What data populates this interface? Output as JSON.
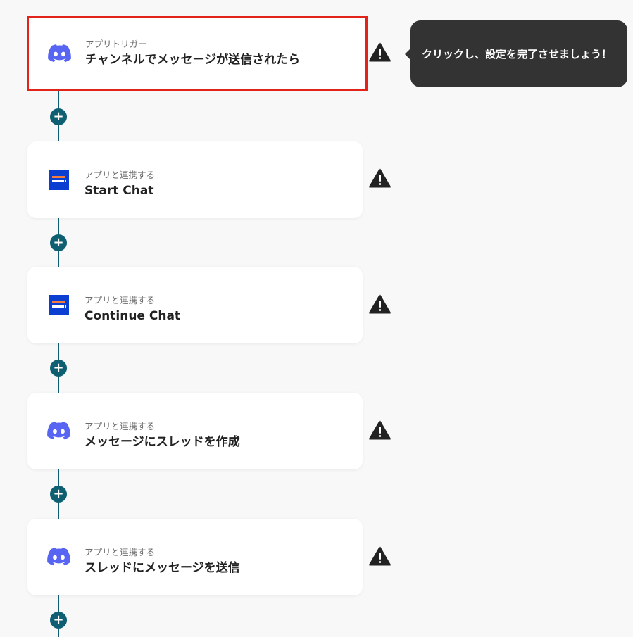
{
  "colors": {
    "background": "#f8f8f8",
    "flow_line": "#0f5f73",
    "selected_border": "#e2231a",
    "tooltip_bg": "#333333",
    "discord_brand": "#5865f2",
    "chat_app_brand": "#0b3fd1",
    "chat_app_accent": "#f47c3c"
  },
  "tooltip": {
    "text": "クリックし、設定を完了させましょう！"
  },
  "steps": [
    {
      "app_icon": "discord-icon",
      "subtitle": "アプリトリガー",
      "title": "チャンネルでメッセージが送信されたら",
      "selected": true,
      "warning": true
    },
    {
      "app_icon": "chat-app-icon",
      "subtitle": "アプリと連携する",
      "title": "Start Chat",
      "selected": false,
      "warning": true
    },
    {
      "app_icon": "chat-app-icon",
      "subtitle": "アプリと連携する",
      "title": "Continue Chat",
      "selected": false,
      "warning": true
    },
    {
      "app_icon": "discord-icon",
      "subtitle": "アプリと連携する",
      "title": "メッセージにスレッドを作成",
      "selected": false,
      "warning": true
    },
    {
      "app_icon": "discord-icon",
      "subtitle": "アプリと連携する",
      "title": "スレッドにメッセージを送信",
      "selected": false,
      "warning": true
    }
  ],
  "add_step_buttons": [
    {
      "icon": "plus-icon",
      "label": "+"
    },
    {
      "icon": "plus-icon",
      "label": "+"
    },
    {
      "icon": "plus-icon",
      "label": "+"
    },
    {
      "icon": "plus-icon",
      "label": "+"
    },
    {
      "icon": "plus-icon",
      "label": "+"
    }
  ]
}
